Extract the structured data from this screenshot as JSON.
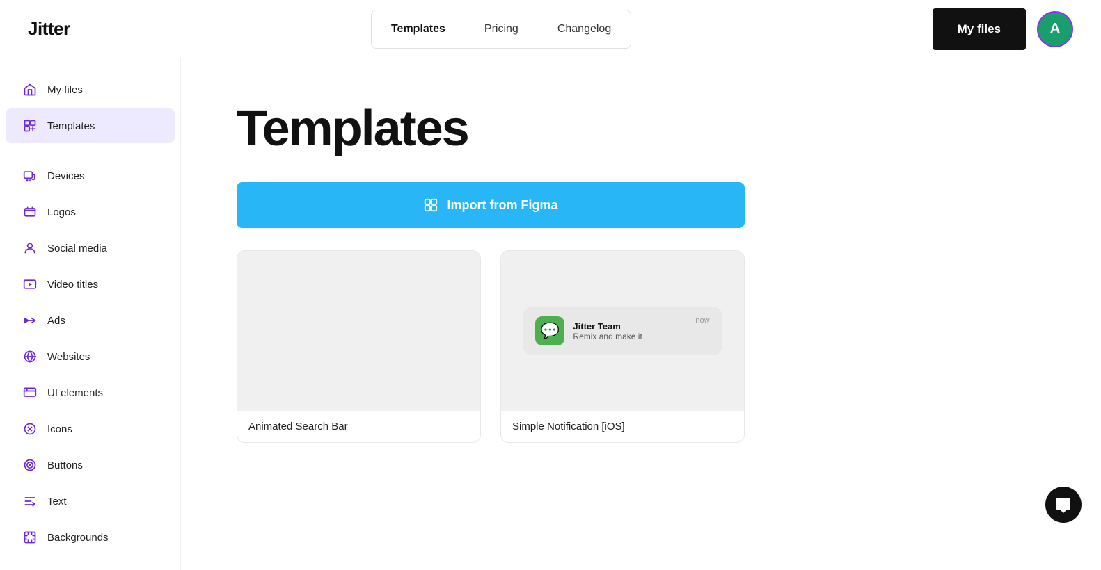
{
  "header": {
    "logo": "Jitter",
    "nav": [
      {
        "label": "Templates",
        "active": true
      },
      {
        "label": "Pricing",
        "active": false
      },
      {
        "label": "Changelog",
        "active": false
      }
    ],
    "my_files_label": "My files",
    "avatar_letter": "A"
  },
  "sidebar": {
    "items_top": [
      {
        "label": "My files",
        "icon": "home-icon",
        "active": false
      },
      {
        "label": "Templates",
        "icon": "templates-icon",
        "active": true
      }
    ],
    "items_bottom": [
      {
        "label": "Devices",
        "icon": "devices-icon",
        "active": false
      },
      {
        "label": "Logos",
        "icon": "logos-icon",
        "active": false
      },
      {
        "label": "Social media",
        "icon": "social-media-icon",
        "active": false
      },
      {
        "label": "Video titles",
        "icon": "video-titles-icon",
        "active": false
      },
      {
        "label": "Ads",
        "icon": "ads-icon",
        "active": false
      },
      {
        "label": "Websites",
        "icon": "websites-icon",
        "active": false
      },
      {
        "label": "UI elements",
        "icon": "ui-elements-icon",
        "active": false
      },
      {
        "label": "Icons",
        "icon": "icons-icon",
        "active": false
      },
      {
        "label": "Buttons",
        "icon": "buttons-icon",
        "active": false
      },
      {
        "label": "Text",
        "icon": "text-icon",
        "active": false
      },
      {
        "label": "Backgrounds",
        "icon": "backgrounds-icon",
        "active": false
      }
    ]
  },
  "main": {
    "page_title": "Templates",
    "import_button_label": "Import from Figma",
    "cards": [
      {
        "label": "Animated Search Bar",
        "type": "search-bar"
      },
      {
        "label": "Simple Notification [iOS]",
        "type": "notification"
      }
    ]
  },
  "notification_mockup": {
    "title": "Jitter Team",
    "text": "Remix and make it",
    "time": "now"
  },
  "colors": {
    "accent_purple": "#6d28d9",
    "active_bg": "#ede9fe",
    "import_btn": "#29b6f6",
    "avatar_bg": "#1a9e6e"
  }
}
